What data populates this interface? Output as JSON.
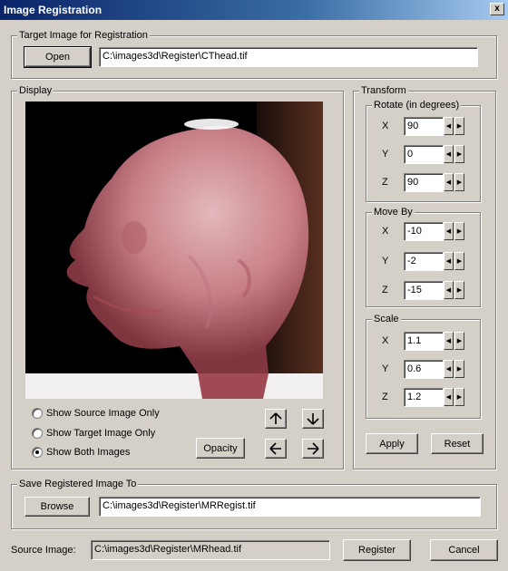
{
  "window": {
    "title": "Image Registration",
    "close_label": "x"
  },
  "target_group": {
    "legend": "Target Image for Registration",
    "open_label": "Open",
    "path": "C:\\images3d\\Register\\CThead.tif"
  },
  "display_group": {
    "legend": "Display",
    "radio_options": [
      {
        "label": "Show Source Image Only",
        "selected": false
      },
      {
        "label": "Show Target Image Only",
        "selected": false
      },
      {
        "label": "Show Both  Images",
        "selected": true
      }
    ],
    "opacity_label": "Opacity",
    "nav_arrows": [
      "arrow-up-icon",
      "arrow-down-icon",
      "arrow-left-icon",
      "arrow-right-icon"
    ]
  },
  "transform_group": {
    "legend": "Transform",
    "rotate": {
      "legend": "Rotate (in degrees)",
      "x_label": "X",
      "x": "90",
      "y_label": "Y",
      "y": "0",
      "z_label": "Z",
      "z": "90"
    },
    "move_by": {
      "legend": "Move By",
      "x_label": "X",
      "x": "-10",
      "y_label": "Y",
      "y": "-2",
      "z_label": "Z",
      "z": "-15"
    },
    "scale": {
      "legend": "Scale",
      "x_label": "X",
      "x": "1.1",
      "y_label": "Y",
      "y": "0.6",
      "z_label": "Z",
      "z": "1.2"
    },
    "apply_label": "Apply",
    "reset_label": "Reset"
  },
  "save_group": {
    "legend": "Save Registered Image To",
    "browse_label": "Browse",
    "path": "C:\\images3d\\Register\\MRRegist.tif"
  },
  "footer": {
    "source_label": "Source Image:",
    "source_path": "C:\\images3d\\Register\\MRhead.tif",
    "register_label": "Register",
    "cancel_label": "Cancel"
  },
  "colors": {
    "titlebar": "#0a246a",
    "dialog_bg": "#d4d0c8",
    "render_bg": "#000000",
    "head_tint": "#e8a0a8"
  }
}
